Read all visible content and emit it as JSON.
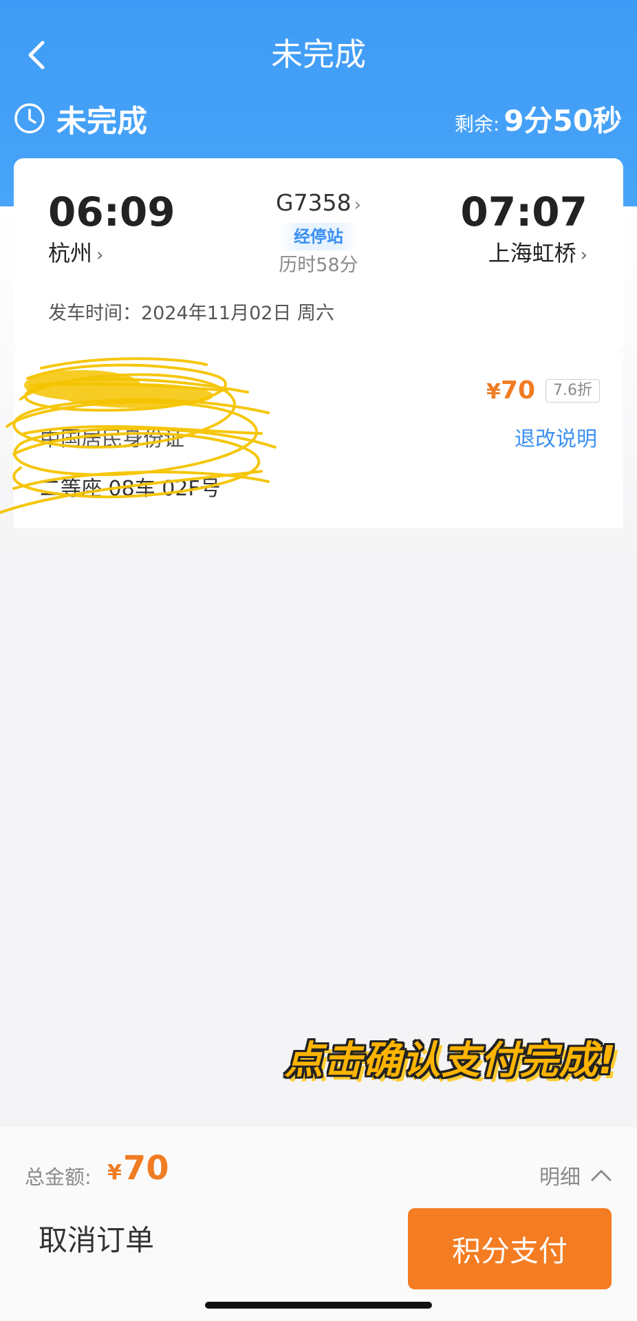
{
  "header": {
    "title": "未完成",
    "status": "未完成",
    "remaining_label": "剩余:",
    "remaining_time": "9分50秒"
  },
  "train": {
    "departure_time": "06:09",
    "departure_station": "杭州",
    "arrival_time": "07:07",
    "arrival_station": "上海虹桥",
    "train_number": "G7358",
    "stops_label": "经停站",
    "duration": "历时58分",
    "departure_date": "发车时间：2024年11月02日 周六"
  },
  "passenger": {
    "id_type": "中国居民身份证",
    "seat": "二等座 08车 02F号",
    "price": "70",
    "currency": "¥",
    "discount": "7.6折",
    "refund_link": "退改说明"
  },
  "overlay": {
    "caption": "点击确认支付完成!"
  },
  "footer": {
    "total_label": "总金额:",
    "currency": "¥",
    "total_amount": "70",
    "detail_label": "明细",
    "cancel_label": "取消订单",
    "pay_label": "积分支付"
  },
  "colors": {
    "header_blue": "#3f9cf6",
    "accent_orange": "#f47c22",
    "link_blue": "#3a8ff2",
    "scribble_yellow": "#f5c400"
  },
  "icons": [
    "back-chevron-icon",
    "clock-icon",
    "chevron-right-icon",
    "chevron-up-icon"
  ]
}
